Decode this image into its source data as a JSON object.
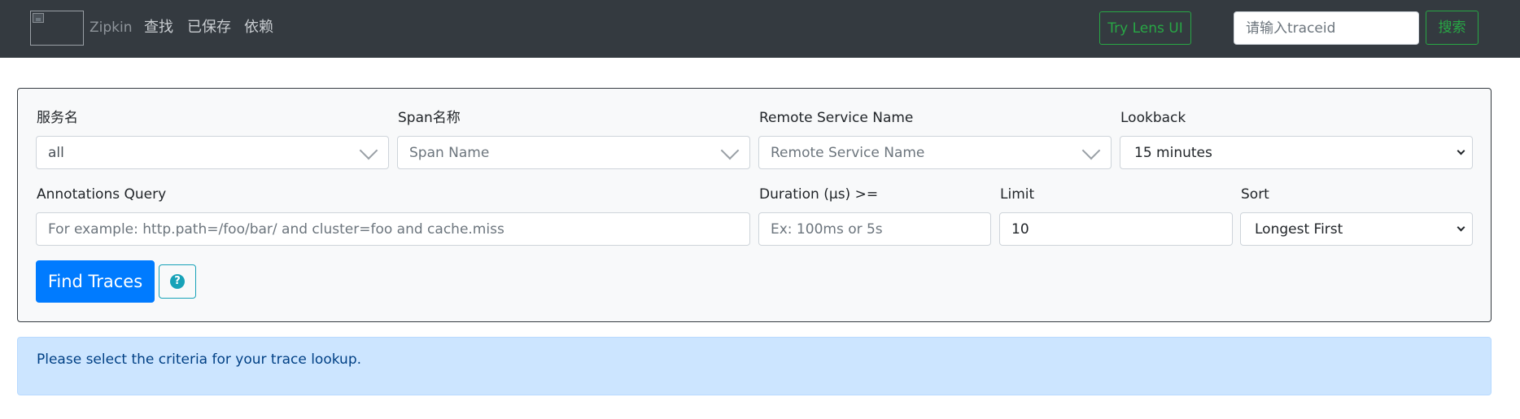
{
  "navbar": {
    "brand_name": "Zipkin",
    "links": [
      {
        "label": "查找"
      },
      {
        "label": "已保存"
      },
      {
        "label": "依赖"
      }
    ],
    "try_lens_label": "Try Lens UI",
    "traceid_placeholder": "请输入traceid",
    "search_label": "搜索"
  },
  "search": {
    "service_name": {
      "label": "服务名",
      "value": "all"
    },
    "span_name": {
      "label": "Span名称",
      "placeholder": "Span Name"
    },
    "remote_service": {
      "label": "Remote Service Name",
      "placeholder": "Remote Service Name"
    },
    "lookback": {
      "label": "Lookback",
      "value": "15 minutes"
    },
    "annotations": {
      "label": "Annotations Query",
      "placeholder": "For example: http.path=/foo/bar/ and cluster=foo and cache.miss"
    },
    "duration": {
      "label": "Duration (μs) >=",
      "placeholder": "Ex: 100ms or 5s"
    },
    "limit": {
      "label": "Limit",
      "value": "10"
    },
    "sort": {
      "label": "Sort",
      "value": "Longest First"
    },
    "find_label": "Find Traces",
    "help_glyph": "?"
  },
  "info": {
    "message": "Please select the criteria for your trace lookup."
  },
  "colors": {
    "navbar_bg": "#343a40",
    "success": "#28a745",
    "primary": "#007bff",
    "info": "#17a2b8",
    "alert_bg": "#cce5ff"
  }
}
